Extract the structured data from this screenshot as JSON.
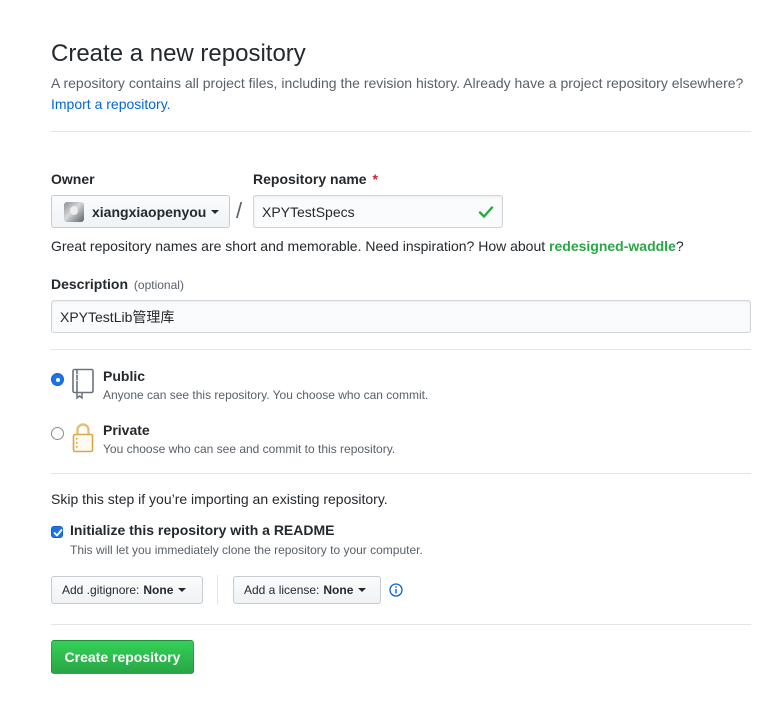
{
  "header": {
    "title": "Create a new repository",
    "subtitle": "A repository contains all project files, including the revision history. Already have a project repository elsewhere?",
    "import_link": "Import a repository."
  },
  "owner": {
    "label": "Owner",
    "value": "xiangxiaopenyou"
  },
  "repo_name": {
    "label": "Repository name",
    "required_mark": "*",
    "value": "XPYTestSpecs",
    "separator": "/"
  },
  "name_hint": {
    "prefix": "Great repository names are short and memorable. Need inspiration? How about",
    "suggestion": "redesigned-waddle",
    "suffix": "?"
  },
  "description": {
    "label": "Description",
    "optional": "(optional)",
    "value": "XPYTestLib管理库"
  },
  "visibility": {
    "public": {
      "title": "Public",
      "desc": "Anyone can see this repository. You choose who can commit.",
      "selected": true
    },
    "private": {
      "title": "Private",
      "desc": "You choose who can see and commit to this repository.",
      "selected": false
    }
  },
  "init": {
    "skip_text": "Skip this step if you’re importing an existing repository.",
    "readme_title": "Initialize this repository with a README",
    "readme_desc": "This will let you immediately clone the repository to your computer.",
    "readme_checked": true
  },
  "gitignore": {
    "label": "Add .gitignore:",
    "value": "None"
  },
  "license": {
    "label": "Add a license:",
    "value": "None"
  },
  "submit": {
    "label": "Create repository"
  },
  "colors": {
    "accent_blue": "#0366d6",
    "success_green": "#28a745",
    "required_red": "#cb2431"
  }
}
